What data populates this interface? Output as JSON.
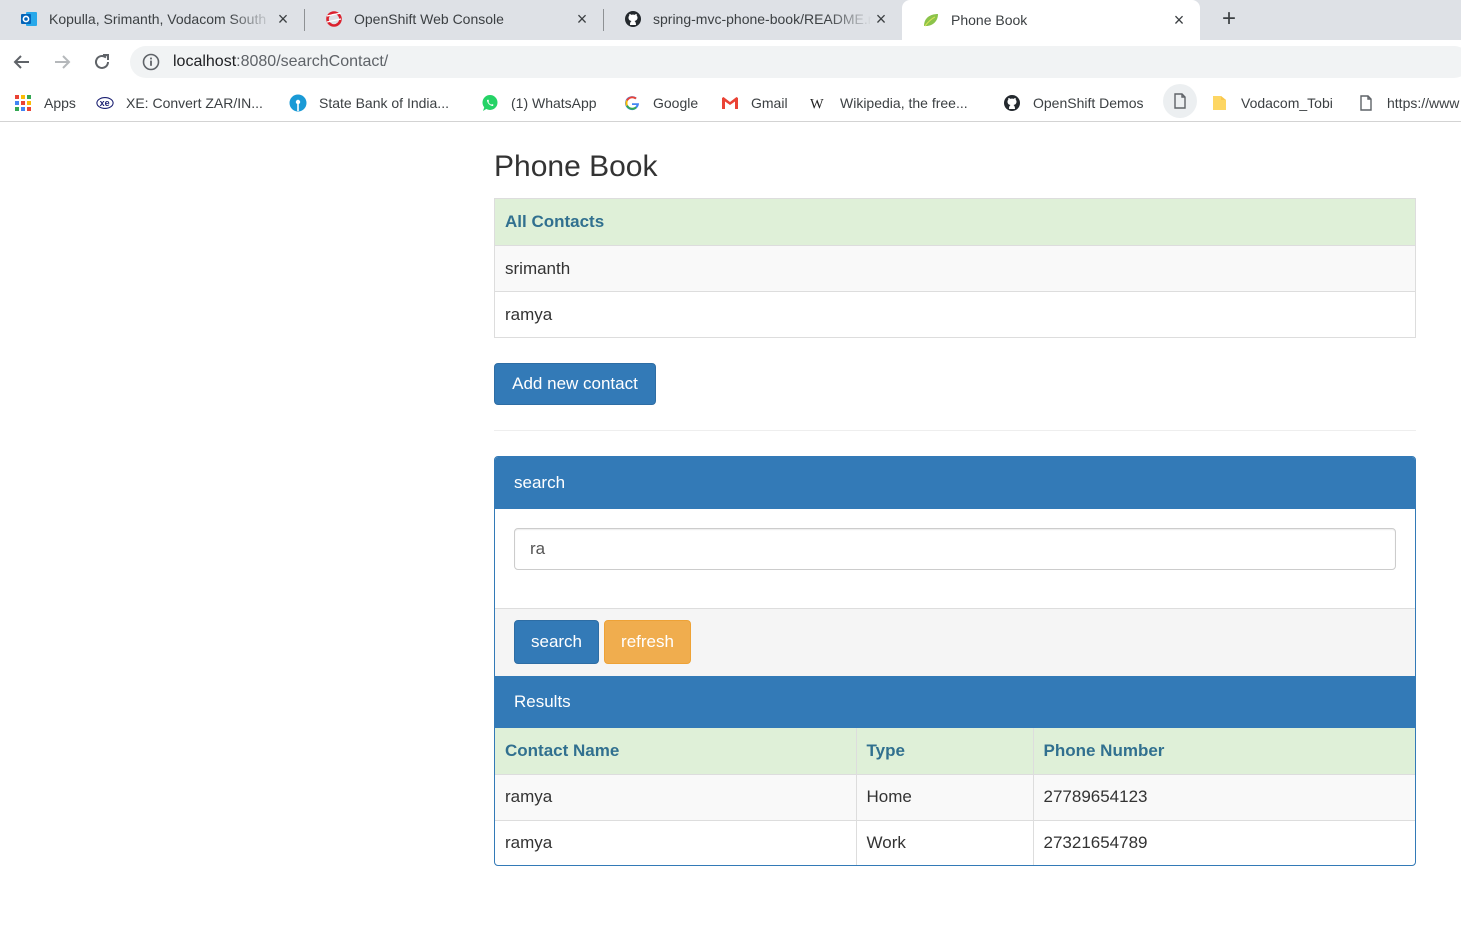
{
  "browser": {
    "tabs": [
      {
        "title": "Kopulla, Srimanth, Vodacom South",
        "icon": "outlook-icon",
        "active": false
      },
      {
        "title": "OpenShift Web Console",
        "icon": "openshift-icon",
        "active": false
      },
      {
        "title": "spring-mvc-phone-book/README.md",
        "icon": "github-icon",
        "active": false
      },
      {
        "title": "Phone Book",
        "icon": "spring-leaf-icon",
        "active": true
      }
    ],
    "url_host": "localhost",
    "url_path": ":8080/searchContact/",
    "bookmarks": [
      {
        "label": "Apps",
        "icon": "apps-grid-icon"
      },
      {
        "label": "XE: Convert ZAR/IN...",
        "icon": "xe-icon"
      },
      {
        "label": "State Bank of India...",
        "icon": "sbi-icon"
      },
      {
        "label": "(1) WhatsApp",
        "icon": "whatsapp-icon"
      },
      {
        "label": "Google",
        "icon": "google-icon"
      },
      {
        "label": "Gmail",
        "icon": "gmail-icon"
      },
      {
        "label": "Wikipedia, the free...",
        "icon": "wikipedia-icon"
      },
      {
        "label": "OpenShift Demos",
        "icon": "github-icon"
      },
      {
        "label": "Vodacom_Tobi",
        "icon": "folder-icon"
      },
      {
        "label": "https://www",
        "icon": "page-icon"
      }
    ],
    "colors": {
      "tabstrip": "#dee1e6",
      "omnibox": "#f1f3f4"
    }
  },
  "page": {
    "title": "Phone Book",
    "contacts": {
      "header": "All Contacts",
      "items": [
        "srimanth",
        "ramya"
      ]
    },
    "add_button": "Add new contact",
    "search": {
      "heading": "search",
      "value": "ra",
      "search_button": "search",
      "refresh_button": "refresh"
    },
    "results": {
      "heading": "Results",
      "columns": [
        "Contact Name",
        "Type",
        "Phone Number"
      ],
      "rows": [
        [
          "ramya",
          "Home",
          "27789654123"
        ],
        [
          "ramya",
          "Work",
          "27321654789"
        ]
      ]
    },
    "colors": {
      "primary": "#337ab7",
      "warning": "#f0ad4e",
      "success_bg": "#dff0d8",
      "info_text": "#31708f"
    }
  }
}
